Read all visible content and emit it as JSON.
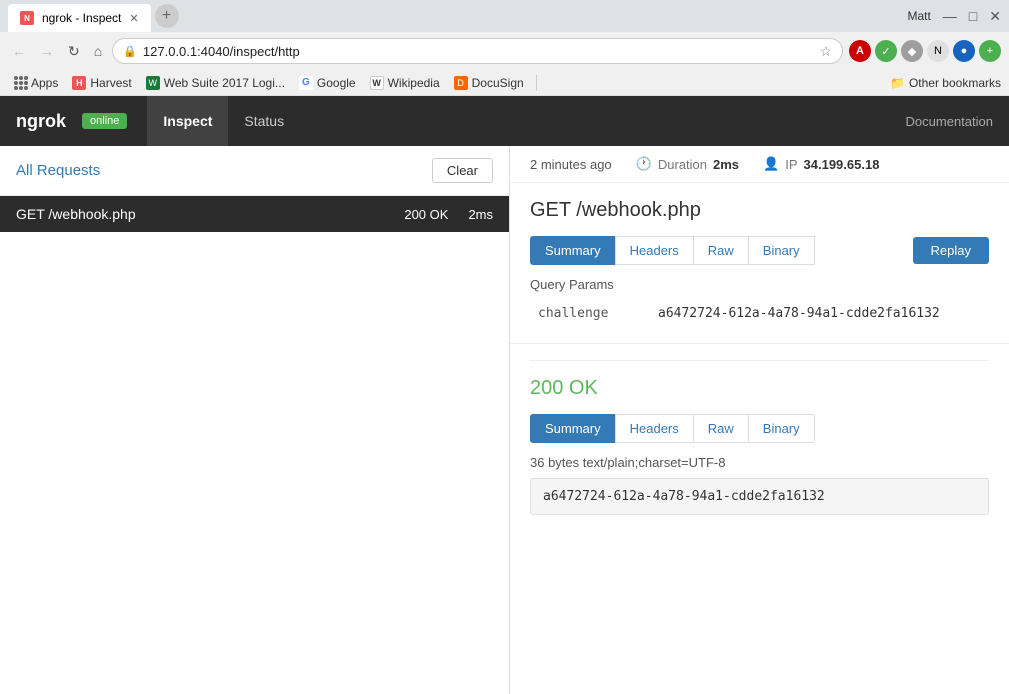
{
  "browser": {
    "tab_title": "ngrok - Inspect",
    "url": "127.0.0.1:4040/inspect/http",
    "url_full": "127.0.0.1:4040/inspect/http",
    "window_user": "Matt"
  },
  "bookmarks": {
    "apps_label": "Apps",
    "items": [
      {
        "label": "Harvest",
        "color": "#e55"
      },
      {
        "label": "Web Suite 2017 Logi..."
      },
      {
        "label": "Google"
      },
      {
        "label": "Wikipedia"
      },
      {
        "label": "DocuSign"
      }
    ],
    "other_label": "Other bookmarks"
  },
  "app": {
    "logo": "ngrok",
    "badge": "online",
    "nav": [
      {
        "label": "Inspect",
        "active": true
      },
      {
        "label": "Status",
        "active": false
      }
    ],
    "docs_link": "Documentation"
  },
  "left_panel": {
    "title": "All Requests",
    "clear_btn": "Clear",
    "requests": [
      {
        "method": "GET",
        "path": "/webhook.php",
        "status": "200 OK",
        "duration": "2ms",
        "selected": true
      }
    ]
  },
  "request_meta": {
    "time_ago": "2 minutes ago",
    "duration_label": "Duration",
    "duration_value": "2ms",
    "ip_label": "IP",
    "ip_value": "34.199.65.18"
  },
  "request_detail": {
    "title": "GET /webhook.php",
    "tabs": [
      {
        "label": "Summary",
        "active": true
      },
      {
        "label": "Headers",
        "active": false
      },
      {
        "label": "Raw",
        "active": false
      },
      {
        "label": "Binary",
        "active": false
      }
    ],
    "replay_btn": "Replay",
    "query_params_label": "Query Params",
    "params": [
      {
        "key": "challenge",
        "value": "a6472724-612a-4a78-94a1-cdde2fa16132"
      }
    ]
  },
  "response_detail": {
    "title": "200 OK",
    "tabs": [
      {
        "label": "Summary",
        "active": true
      },
      {
        "label": "Headers",
        "active": false
      },
      {
        "label": "Raw",
        "active": false
      },
      {
        "label": "Binary",
        "active": false
      }
    ],
    "content_type": "36 bytes text/plain;charset=UTF-8",
    "body": "a6472724-612a-4a78-94a1-cdde2fa16132"
  }
}
